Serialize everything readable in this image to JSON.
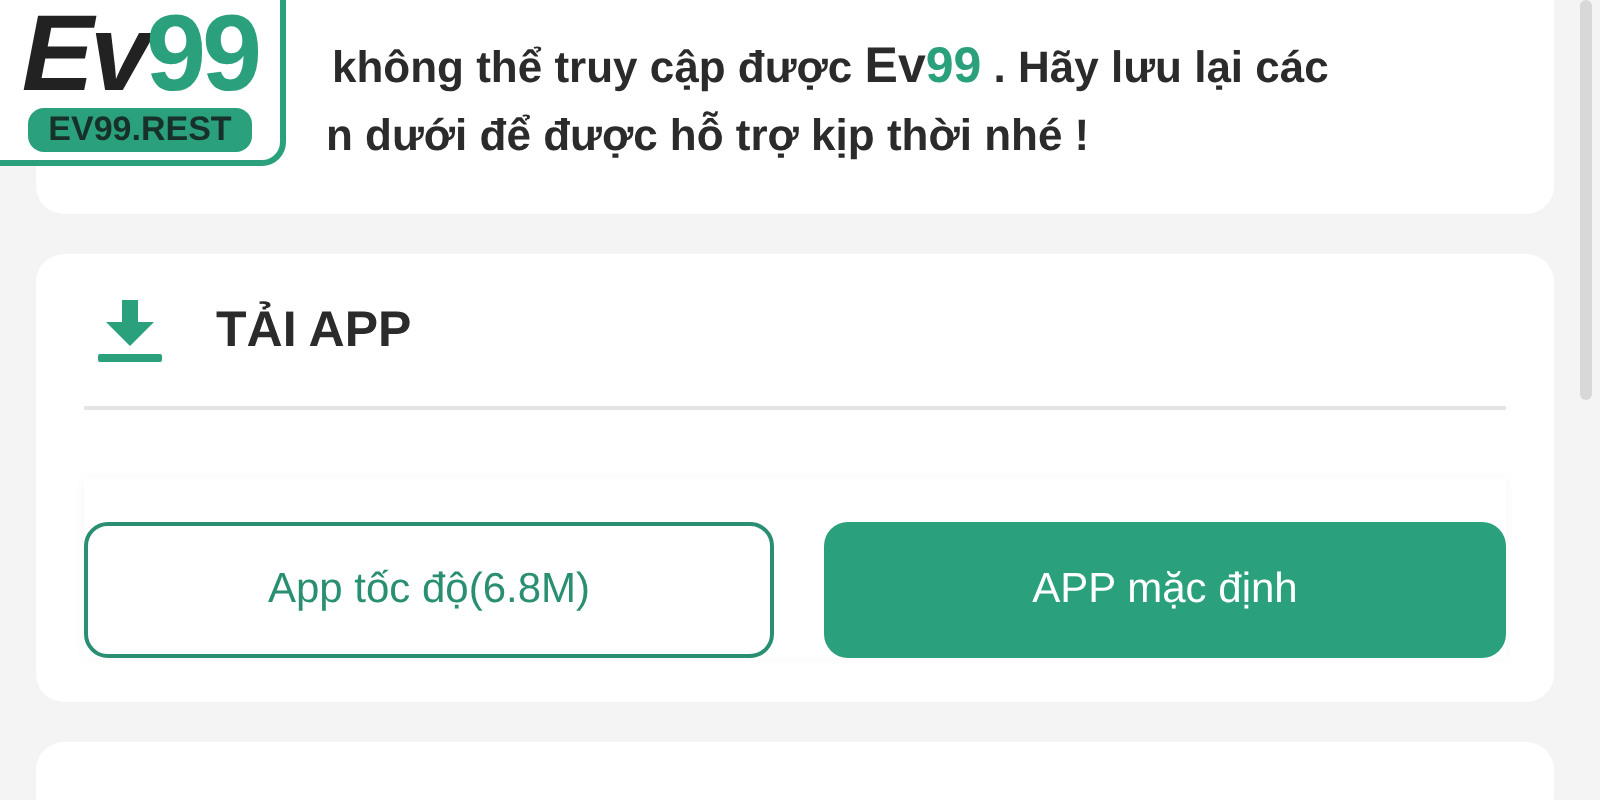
{
  "logo": {
    "brand_dark": "Ev",
    "brand_green": "99",
    "badge": "EV99.REST"
  },
  "notice": {
    "line_1": {
      "before": "không thể truy cập được ",
      "brand_dark": "Ev",
      "brand_green": "99",
      "after": " . Hãy lưu lại các"
    },
    "line_2": "n dưới để được hỗ trợ kịp thời nhé !"
  },
  "download": {
    "title": "TẢI APP",
    "buttons": [
      {
        "label": "App tốc độ(6.8M)",
        "kind": "outline"
      },
      {
        "label": "APP mặc định",
        "kind": "filled"
      }
    ]
  }
}
